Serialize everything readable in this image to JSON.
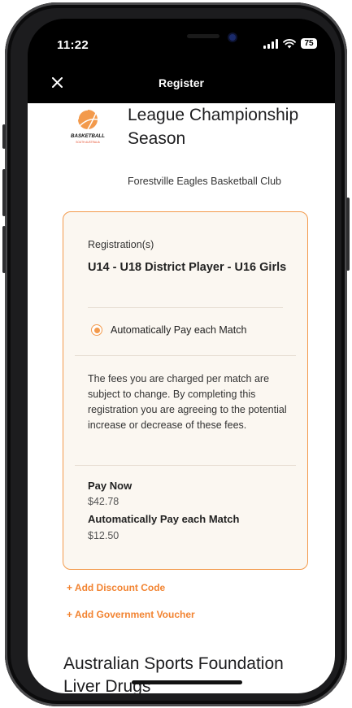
{
  "status_bar": {
    "time": "11:22",
    "battery": "75"
  },
  "nav": {
    "title": "Register"
  },
  "event": {
    "logo_text": "BASKETBALL",
    "logo_subtext": "SOUTH AUSTRALIA",
    "title": "League Championship Season",
    "club": "Forestville Eagles Basketball Club"
  },
  "registration": {
    "label": "Registration(s)",
    "name": "U14 - U18 District Player - U16 Girls",
    "payment_option": "Automatically Pay each Match",
    "note": "The fees you are charged per match are subject to change. By completing this registration you are agreeing to the potential increase or decrease of these fees.",
    "pay_now_label": "Pay Now",
    "pay_now_value": "$42.78",
    "auto_pay_label": "Automatically Pay each Match",
    "auto_pay_value": "$12.50"
  },
  "links": {
    "discount": "+ Add Discount Code",
    "voucher": "+ Add Government Voucher"
  },
  "section": {
    "title": "Australian Sports Foundation Liver Drugs"
  },
  "colors": {
    "accent": "#f39a4c",
    "link": "#f28432"
  }
}
